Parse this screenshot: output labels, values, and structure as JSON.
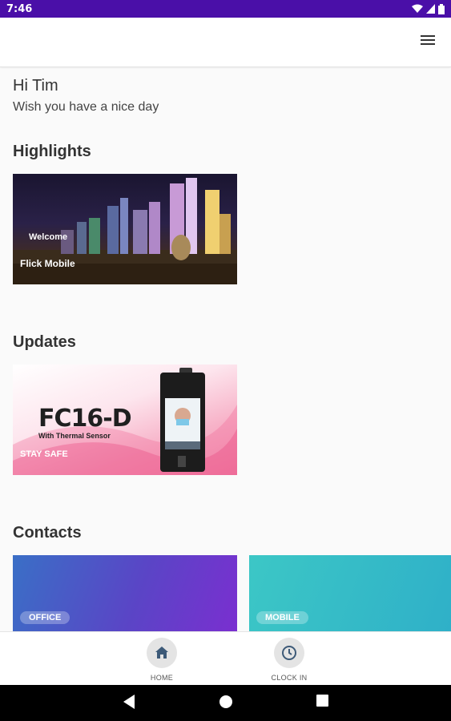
{
  "status_bar": {
    "time": "7:46"
  },
  "greeting": {
    "hello": "Hi Tim",
    "message": "Wish you have a nice day"
  },
  "highlights": {
    "title": "Highlights",
    "card": {
      "welcome": "Welcome",
      "title": "Flick Mobile"
    }
  },
  "updates": {
    "title": "Updates",
    "card": {
      "model": "FC16-D",
      "sensor": "With Thermal Sensor",
      "tagline": "STAY SAFE"
    }
  },
  "contacts": {
    "title": "Contacts",
    "items": [
      {
        "label": "OFFICE"
      },
      {
        "label": "MOBILE"
      }
    ]
  },
  "bottom_nav": {
    "items": [
      {
        "label": "HOME",
        "icon": "home-icon"
      },
      {
        "label": "CLOCK IN",
        "icon": "clock-icon"
      }
    ]
  },
  "colors": {
    "status_bar": "#4a0fa8",
    "office_gradient": [
      "#3a6fc6",
      "#7a2fd0"
    ],
    "mobile_gradient": [
      "#3cc7c6",
      "#2fb0c8"
    ]
  }
}
